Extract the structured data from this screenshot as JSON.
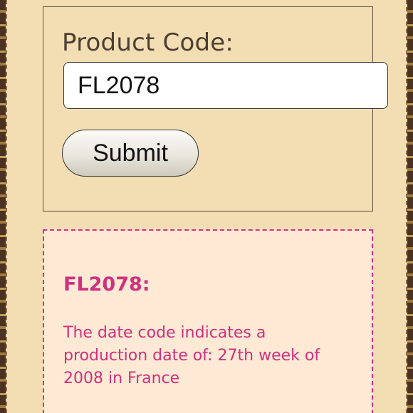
{
  "form": {
    "label": "Product Code:",
    "input_value": "FL2078",
    "submit_label": "Submit"
  },
  "result": {
    "title": "FL2078:",
    "text": "The date code indicates a production date of: 27th week of 2008 in France"
  },
  "colors": {
    "page_background": "#f3deb4",
    "result_background": "#fde9d4",
    "result_accent": "#d0307f",
    "label_text": "#4d3e33"
  }
}
